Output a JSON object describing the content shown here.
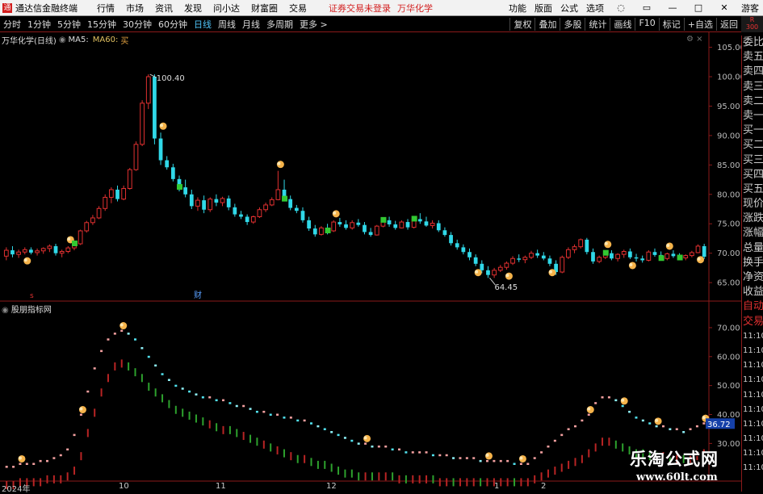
{
  "app": {
    "title": "通达信金融终端",
    "icon_text": "通"
  },
  "menu": [
    "行情",
    "市场",
    "资讯",
    "发现",
    "问小达",
    "财富圈",
    "交易"
  ],
  "notice": "证券交易未登录",
  "stock_name": "万华化学",
  "menubar_right": [
    "功能",
    "版面",
    "公式",
    "选项"
  ],
  "user_label": "游客",
  "periods": [
    "分时",
    "1分钟",
    "5分钟",
    "15分钟",
    "30分钟",
    "60分钟",
    "日线",
    "周线",
    "月线",
    "多周期",
    "更多 >"
  ],
  "active_period": "日线",
  "tools": [
    "复权",
    "叠加",
    "多股",
    "统计",
    "画线",
    "F10",
    "标记",
    "+自选",
    "返回"
  ],
  "r_badge": "R\n300",
  "legend": {
    "name": "万华化学(日线)",
    "ma5": "MA5:",
    "ma60": "MA60:",
    "signal": "买"
  },
  "indicator_name": "股朋指标网",
  "main_axis": {
    "min": 62,
    "max": 107,
    "ticks": [
      "105.00",
      "100.00",
      "95.00",
      "90.00",
      "85.00",
      "80.00",
      "75.00",
      "70.00",
      "65.00"
    ],
    "tick_values": [
      105,
      100,
      95,
      90,
      85,
      80,
      75,
      70,
      65
    ]
  },
  "sub_axis": {
    "min": 17,
    "max": 75,
    "ticks": [
      "70.00",
      "60.00",
      "50.00",
      "40.00",
      "30.00"
    ],
    "tick_values": [
      70,
      60,
      50,
      40,
      30
    ],
    "current": "36.72"
  },
  "annotations": {
    "peak": "100.40",
    "low": "64.45",
    "cai": "财"
  },
  "xaxis": [
    "2024年",
    "10",
    "11",
    "12",
    "1",
    "2"
  ],
  "sidepanel": [
    "委比",
    "卖五",
    "卖四",
    "卖三",
    "卖二",
    "卖一",
    "买一",
    "买二",
    "买三",
    "买四",
    "买五",
    "现价",
    "涨跌",
    "涨幅",
    "总量",
    "换手",
    "净资",
    "收益",
    "自动",
    "交易",
    "11:10",
    "11:10",
    "11:10",
    "11:10",
    "11:10",
    "11:10",
    "11:10",
    "11:10",
    "11:10",
    "11:10"
  ],
  "watermark": {
    "title": "乐淘公式网",
    "url": "www.60lt.com"
  },
  "colors": {
    "up": "#e03030",
    "down": "#30d8e8",
    "bg": "#000000",
    "border": "#8b1a1a"
  },
  "chart_data": {
    "type": "candlestick",
    "candles": [
      [
        69.5,
        71,
        68.8,
        70.5
      ],
      [
        70.5,
        71.2,
        69.3,
        69.8
      ],
      [
        69.8,
        70.6,
        69.2,
        70.2
      ],
      [
        70.2,
        71,
        69.8,
        70.6
      ],
      [
        70.6,
        71,
        69.8,
        70.1
      ],
      [
        70.1,
        70.8,
        69.6,
        70.4
      ],
      [
        70.4,
        71,
        69.9,
        70.8
      ],
      [
        70.8,
        71.5,
        70.2,
        71.2
      ],
      [
        71.2,
        71.6,
        69.6,
        70
      ],
      [
        70,
        70.6,
        69.3,
        70.3
      ],
      [
        70.3,
        71.2,
        70,
        70.9
      ],
      [
        70.9,
        72,
        70.5,
        71.6
      ],
      [
        71.6,
        74,
        71.4,
        73.8
      ],
      [
        73.8,
        75.5,
        73.5,
        75.2
      ],
      [
        75.2,
        76.5,
        74.8,
        76
      ],
      [
        76,
        78,
        75.8,
        77.6
      ],
      [
        77.6,
        80,
        77.2,
        79.5
      ],
      [
        79.5,
        81.2,
        78.5,
        80.8
      ],
      [
        80.8,
        81.5,
        78.8,
        79.2
      ],
      [
        79.2,
        81.5,
        79,
        81
      ],
      [
        81,
        84.5,
        80.8,
        84.2
      ],
      [
        84.2,
        89,
        84,
        88.5
      ],
      [
        88.5,
        96,
        88.2,
        95.5
      ],
      [
        95.5,
        100.4,
        94.5,
        100
      ],
      [
        100,
        100.4,
        88.5,
        89.5
      ],
      [
        89.5,
        90.5,
        85,
        85.8
      ],
      [
        85.8,
        86.5,
        84.2,
        84.6
      ],
      [
        84.6,
        85.2,
        82.2,
        82.6
      ],
      [
        82.6,
        83.2,
        80.5,
        81.2
      ],
      [
        81.2,
        82.5,
        79.5,
        80
      ],
      [
        80,
        80.8,
        77.5,
        78
      ],
      [
        78,
        79.5,
        77.2,
        79
      ],
      [
        79,
        79.8,
        76.8,
        77.4
      ],
      [
        77.4,
        79.5,
        77,
        79.2
      ],
      [
        79.2,
        80,
        78,
        78.6
      ],
      [
        78.6,
        79.6,
        78,
        79.3
      ],
      [
        79.3,
        79.8,
        77.3,
        77.8
      ],
      [
        77.8,
        78.4,
        76.2,
        76.6
      ],
      [
        76.6,
        77.2,
        75.8,
        76.2
      ],
      [
        76.2,
        76.6,
        74.8,
        75.3
      ],
      [
        75.3,
        76.4,
        75,
        76.2
      ],
      [
        76.2,
        77.8,
        76,
        77.4
      ],
      [
        77.4,
        78.6,
        77,
        78.2
      ],
      [
        78.2,
        79.5,
        78,
        79.1
      ],
      [
        79.1,
        84,
        79,
        80.8
      ],
      [
        80.8,
        82.5,
        78.8,
        79.2
      ],
      [
        79.2,
        79.8,
        77.3,
        77.7
      ],
      [
        77.7,
        78.2,
        76.8,
        77.2
      ],
      [
        77.2,
        77.8,
        75.2,
        75.6
      ],
      [
        75.6,
        76.2,
        73.8,
        74.2
      ],
      [
        74.2,
        74.8,
        72.8,
        73.2
      ],
      [
        73.2,
        74.6,
        73,
        74.3
      ],
      [
        74.3,
        75,
        73.2,
        73.8
      ],
      [
        73.8,
        75.6,
        73.6,
        75.3
      ],
      [
        75.3,
        76,
        74.5,
        74.9
      ],
      [
        74.9,
        75.6,
        74,
        74.3
      ],
      [
        74.3,
        75.6,
        74,
        75.2
      ],
      [
        75.2,
        75.8,
        74.5,
        74.8
      ],
      [
        74.8,
        75.3,
        73.2,
        73.6
      ],
      [
        73.6,
        74.3,
        72.8,
        73.1
      ],
      [
        73.1,
        74.8,
        73,
        74.6
      ],
      [
        74.6,
        76,
        74.4,
        75.6
      ],
      [
        75.6,
        76.2,
        74.5,
        74.9
      ],
      [
        74.9,
        75.5,
        74,
        74.3
      ],
      [
        74.3,
        75.6,
        74.2,
        75.3
      ],
      [
        75.3,
        75.8,
        74,
        74.4
      ],
      [
        74.4,
        76.2,
        74.2,
        75.8
      ],
      [
        75.8,
        76.8,
        75,
        75.4
      ],
      [
        75.4,
        76.2,
        74.5,
        74.7
      ],
      [
        74.7,
        75.6,
        74.2,
        75.1
      ],
      [
        75.1,
        75.6,
        73.6,
        73.9
      ],
      [
        73.9,
        74.4,
        72.8,
        73.1
      ],
      [
        73.1,
        73.6,
        71.3,
        71.7
      ],
      [
        71.7,
        72.3,
        70.6,
        71
      ],
      [
        71,
        71.5,
        69.8,
        70.2
      ],
      [
        70.2,
        70.8,
        68.8,
        69.3
      ],
      [
        69.3,
        69.8,
        67.8,
        68.2
      ],
      [
        68.2,
        68.8,
        66.6,
        67.1
      ],
      [
        67.1,
        67.8,
        65.8,
        66.3
      ],
      [
        66.3,
        67.5,
        65.8,
        67.1
      ],
      [
        67.1,
        68,
        66.8,
        67.6
      ],
      [
        67.6,
        68.6,
        67.2,
        68.3
      ],
      [
        68.3,
        69.5,
        68,
        69.1
      ],
      [
        69.1,
        69.8,
        68.5,
        68.9
      ],
      [
        68.9,
        69.6,
        68.3,
        69.3
      ],
      [
        69.3,
        70.4,
        69,
        70
      ],
      [
        70,
        70.6,
        69.2,
        69.6
      ],
      [
        69.6,
        70.2,
        68.8,
        69.1
      ],
      [
        69.1,
        69.6,
        67.8,
        68.2
      ],
      [
        68.2,
        68.8,
        66.3,
        66.8
      ],
      [
        66.8,
        69.6,
        66.6,
        69.3
      ],
      [
        69.3,
        71,
        69,
        70.6
      ],
      [
        70.6,
        71.5,
        70,
        71.1
      ],
      [
        71.1,
        72.5,
        70.8,
        72.3
      ],
      [
        72.3,
        72.6,
        69.8,
        70.2
      ],
      [
        70.2,
        70.8,
        68.2,
        68.6
      ],
      [
        68.6,
        69.6,
        68.3,
        69.3
      ],
      [
        69.3,
        70.4,
        69,
        70
      ],
      [
        70,
        70.5,
        68.8,
        69.1
      ],
      [
        69.1,
        70,
        68.6,
        69.8
      ],
      [
        69.8,
        70.6,
        69.2,
        70.3
      ],
      [
        70.3,
        70.8,
        69,
        69.3
      ],
      [
        69.3,
        69.9,
        68.6,
        69.1
      ],
      [
        69.1,
        69.6,
        68.4,
        68.8
      ],
      [
        68.8,
        70.5,
        68.6,
        70.2
      ],
      [
        70.2,
        70.8,
        69.4,
        69.7
      ],
      [
        69.7,
        70.3,
        68.8,
        69.1
      ],
      [
        69.1,
        70.1,
        68.8,
        69.9
      ],
      [
        69.9,
        70.5,
        69.2,
        69.5
      ],
      [
        69.5,
        70,
        68.8,
        69.2
      ],
      [
        69.2,
        69.8,
        68.8,
        69.6
      ],
      [
        69.6,
        70.4,
        69.3,
        70.1
      ],
      [
        70.1,
        71.5,
        70,
        71.2
      ],
      [
        71.2,
        71.6,
        69,
        69.4
      ]
    ],
    "osc_upper": [
      22,
      22,
      23,
      23,
      23,
      24,
      24,
      25,
      26,
      28,
      33,
      40,
      48,
      56,
      62,
      66,
      68,
      69,
      68,
      66,
      63,
      60,
      57,
      54,
      52,
      50,
      49,
      48,
      47,
      46,
      46,
      45,
      45,
      44,
      43,
      43,
      42,
      41,
      41,
      40,
      40,
      39,
      39,
      38,
      38,
      37,
      36,
      35,
      34,
      33,
      32,
      31,
      30,
      30,
      29,
      29,
      29,
      28,
      28,
      27,
      27,
      27,
      27,
      26,
      26,
      26,
      25,
      25,
      25,
      25,
      24,
      24,
      24,
      24,
      24,
      23,
      23,
      23,
      25,
      27,
      29,
      31,
      33,
      35,
      36,
      38,
      40,
      44,
      46,
      46,
      45,
      43,
      41,
      39,
      38,
      37,
      36,
      36,
      35,
      35,
      34,
      35,
      36,
      37
    ],
    "osc_lower": [
      17,
      17,
      18,
      18,
      18,
      18,
      19,
      19,
      19,
      20,
      22,
      27,
      35,
      42,
      49,
      54,
      58,
      59,
      58,
      56,
      54,
      51,
      49,
      47,
      45,
      43,
      42,
      41,
      40,
      39,
      38,
      37,
      36,
      36,
      35,
      34,
      33,
      32,
      31,
      30,
      29,
      28,
      27,
      26,
      26,
      25,
      24,
      24,
      23,
      22,
      21,
      21,
      20,
      20,
      20,
      20,
      20,
      20,
      19,
      19,
      19,
      19,
      19,
      19,
      18,
      18,
      18,
      18,
      18,
      18,
      18,
      18,
      18,
      18,
      18,
      18,
      18,
      18,
      19,
      20,
      21,
      22,
      23,
      24,
      25,
      26,
      28,
      30,
      32,
      32,
      31,
      30,
      29,
      28,
      28,
      27,
      27,
      27,
      26,
      26,
      26,
      26,
      27,
      28
    ]
  }
}
